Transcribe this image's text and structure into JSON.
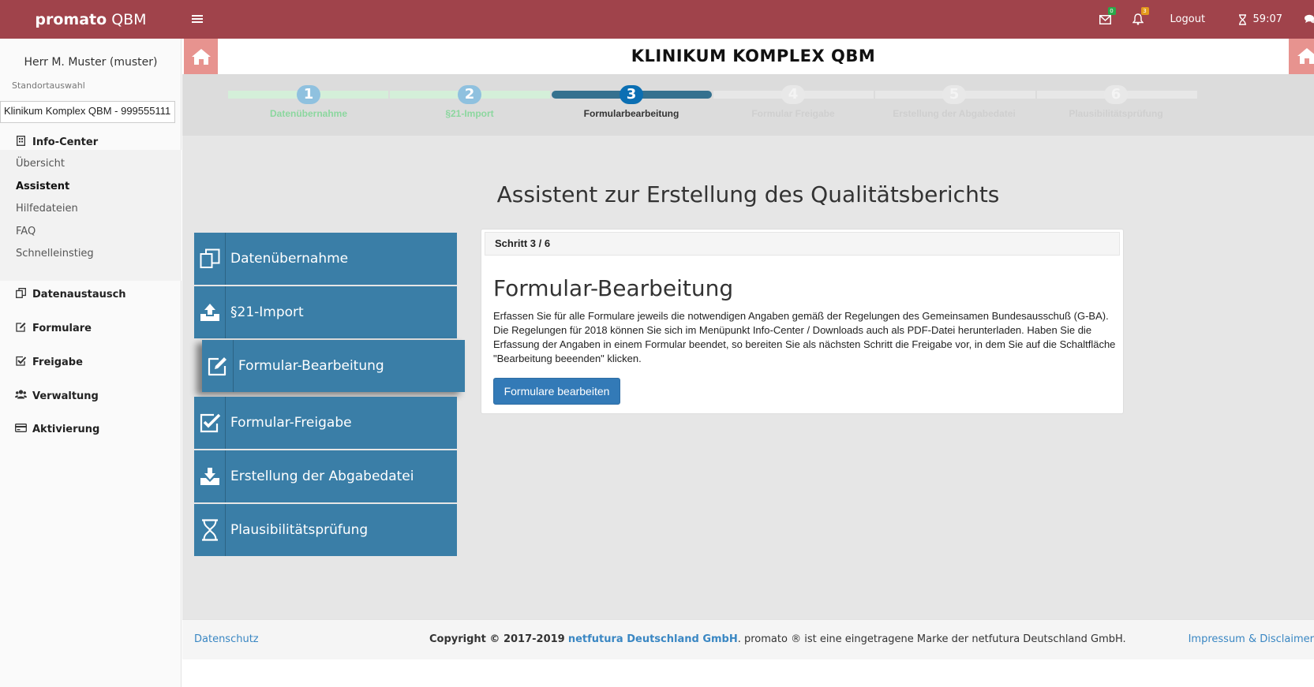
{
  "topbar": {
    "brand_bold": "promato",
    "brand_rest": "QBM",
    "mail_badge": "0",
    "bell_badge": "3",
    "logout_label": "Logout",
    "timer": "59:07",
    "bg_color": "#a0434b"
  },
  "sidebar": {
    "user": "Herr M. Muster (muster)",
    "location_label": "Standortauswahl",
    "location_value": "Klinikum Komplex QBM - 999555111",
    "info_center": "Info-Center",
    "sub_items": [
      {
        "label": "Übersicht"
      },
      {
        "label": "Assistent"
      },
      {
        "label": "Hilfedateien"
      },
      {
        "label": "FAQ"
      },
      {
        "label": "Schnelleinstieg"
      }
    ],
    "nav_items": [
      {
        "label": "Datenaustausch",
        "icon": "copy-icon"
      },
      {
        "label": "Formulare",
        "icon": "edit-icon"
      },
      {
        "label": "Freigabe",
        "icon": "check-square-icon"
      },
      {
        "label": "Verwaltung",
        "icon": "users-icon"
      },
      {
        "label": "Aktivierung",
        "icon": "credit-card-icon"
      }
    ]
  },
  "header": {
    "title": "KLINIKUM KOMPLEX QBM"
  },
  "progress": {
    "current_step": 3,
    "steps": [
      {
        "num": "1",
        "label": "Datenübernahme",
        "state": "done"
      },
      {
        "num": "2",
        "label": "§21-Import",
        "state": "done"
      },
      {
        "num": "3",
        "label": "Formularbearbeitung",
        "state": "current"
      },
      {
        "num": "4",
        "label": "Formular Freigabe",
        "state": "todo"
      },
      {
        "num": "5",
        "label": "Erstellung der Abgabedatei",
        "state": "todo"
      },
      {
        "num": "6",
        "label": "Plausibilitätsprüfung",
        "state": "todo"
      }
    ]
  },
  "main": {
    "heading": "Assistent zur Erstellung des Qualitätsberichts",
    "step_buttons": [
      {
        "label": "Datenübernahme",
        "icon": "copy-icon"
      },
      {
        "label": "§21-Import",
        "icon": "upload-icon"
      },
      {
        "label": "Formular-Bearbeitung",
        "icon": "edit-icon"
      },
      {
        "label": "Formular-Freigabe",
        "icon": "check-square-icon"
      },
      {
        "label": "Erstellung der Abgabedatei",
        "icon": "download-icon"
      },
      {
        "label": "Plausibilitätsprüfung",
        "icon": "hourglass-icon"
      }
    ],
    "panel": {
      "step_text": "Schritt 3 / 6",
      "title": "Formular-Bearbeitung",
      "text": "Erfassen Sie für alle Formulare jeweils die notwendigen Angaben gemäß der Regelungen des Gemeinsamen Bundesausschuß (G-BA). Die Regelungen für 2018 können Sie sich im Menüpunkt Info-Center / Downloads auch als PDF-Datei herunterladen. Haben Sie die Erfassung der Angaben in einem Formular beendet, so bereiten Sie als nächsten Schritt die Freigabe vor, in dem Sie auf die Schaltfläche \"Bearbeitung beeenden\" klicken.",
      "button": "Formulare bearbeiten"
    }
  },
  "footer": {
    "privacy": "Datenschutz",
    "copyright": "Copyright © 2017-2019",
    "company": "netfutura Deutschland GmbH",
    "trademark": ". promato ® ist eine eingetragene Marke der netfutura Deutschland GmbH.",
    "imprint": "Impressum & Disclaimer"
  }
}
